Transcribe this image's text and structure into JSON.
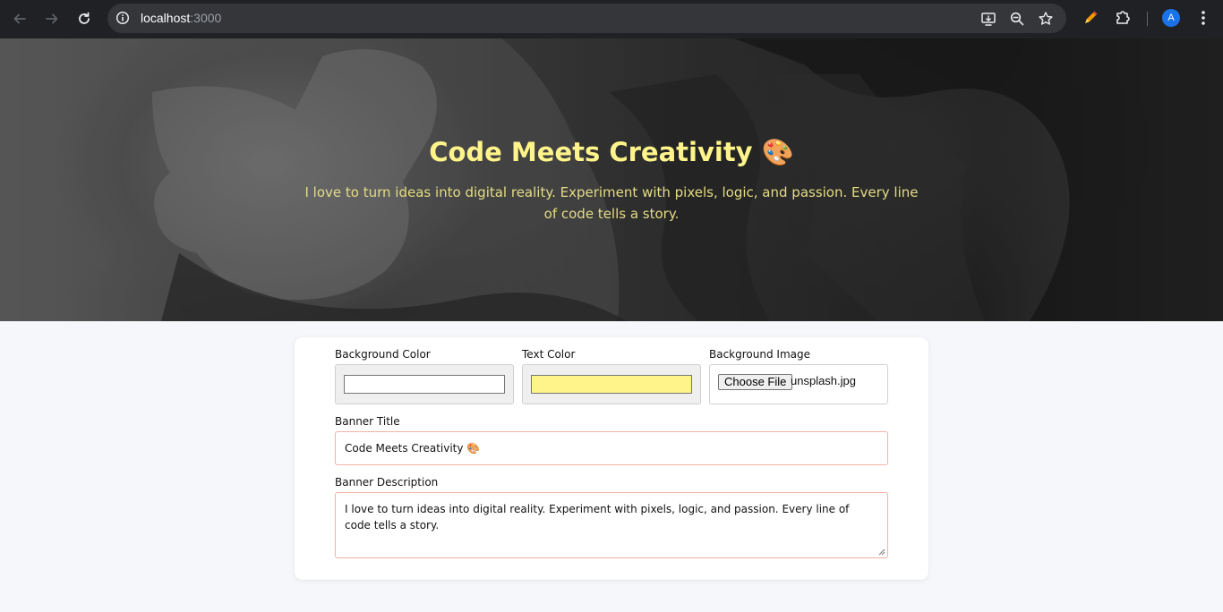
{
  "browser": {
    "url_host": "localhost",
    "url_port": ":3000",
    "profile_initial": "A",
    "icons": {
      "back": "arrow-left-icon",
      "forward": "arrow-right-icon",
      "reload": "reload-icon",
      "site_info": "info-icon",
      "install": "install-app-icon",
      "zoom": "zoom-icon",
      "bookmark": "star-icon",
      "pen_extension": "pen-icon",
      "extensions": "puzzle-icon",
      "menu": "kebab-menu-icon"
    }
  },
  "banner": {
    "title": "Code Meets Creativity 🎨",
    "description": "I love to turn ideas into digital reality. Experiment with pixels, logic, and passion. Every line of code tells a story.",
    "text_color": "#fff48a"
  },
  "form": {
    "background_color": {
      "label": "Background Color",
      "value": "#ffffff"
    },
    "text_color": {
      "label": "Text Color",
      "value": "#fff48a"
    },
    "background_image": {
      "label": "Background Image",
      "button_label": "Choose File",
      "file_name": "unsplash.jpg"
    },
    "banner_title": {
      "label": "Banner Title",
      "value": "Code Meets Creativity 🎨"
    },
    "banner_description": {
      "label": "Banner Description",
      "value": "I love to turn ideas into digital reality. Experiment with pixels, logic, and passion. Every line of code tells a story."
    }
  },
  "colors": {
    "input_border": "#f2b2a6",
    "page_background": "#f5f7fa"
  }
}
